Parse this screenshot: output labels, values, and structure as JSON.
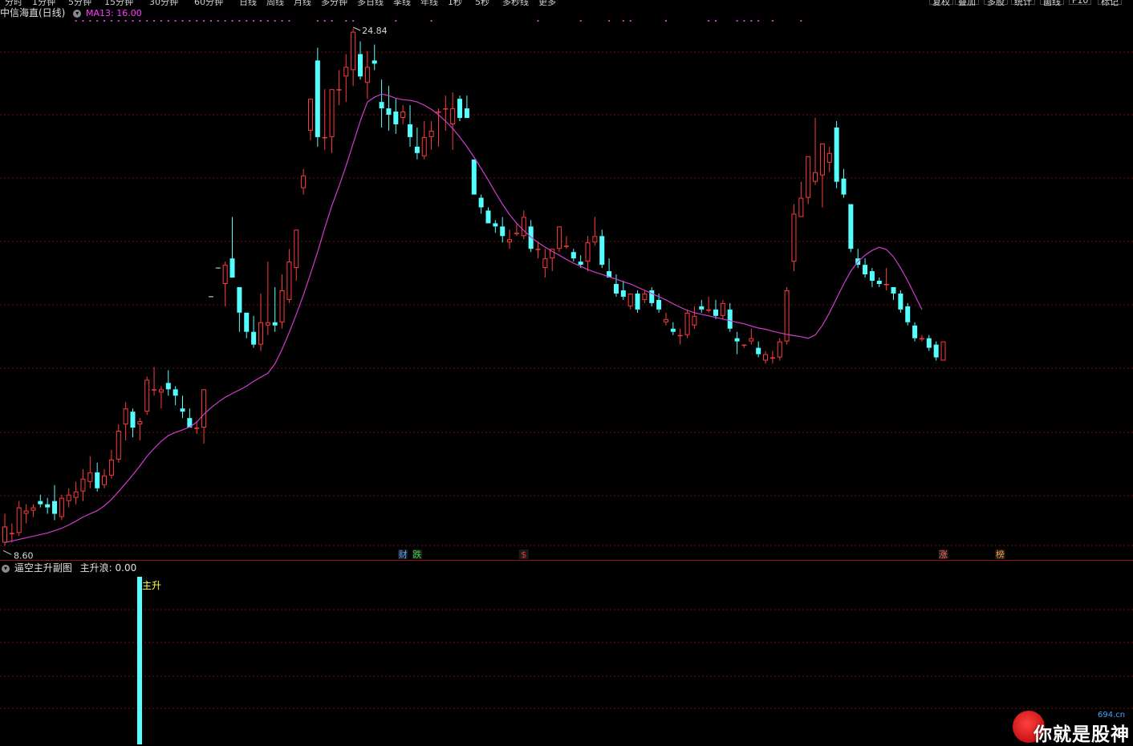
{
  "top_toolbar": {
    "period_tabs": [
      "分时",
      "1分钟",
      "5分钟",
      "15分钟",
      "30分钟",
      "60分钟",
      "日线",
      "周线",
      "月线",
      "多分钟",
      "多日线",
      "季线",
      "年线",
      "1秒",
      "5秒",
      "多秒线",
      "更多"
    ],
    "right_buttons": [
      "复权",
      "叠加",
      "多股",
      "统计",
      "画线",
      "F10",
      "标记"
    ]
  },
  "main_panel": {
    "stock_title": "中信海直(日线)",
    "ma_legend": "MA13: 16.00",
    "high_label": "24.84",
    "low_label": "8.60",
    "event_markers": [
      {
        "text": "财",
        "color": "#5aa0ff"
      },
      {
        "text": "跌",
        "color": "#3fd13f"
      },
      {
        "text": "$",
        "color": "#ff3030"
      },
      {
        "text": "涨",
        "color": "#ff6a6a"
      },
      {
        "text": "榜",
        "color": "#ff9a3a"
      }
    ]
  },
  "sub_panel": {
    "indicator_title": "逼空主升副图",
    "indicator_value": "主升浪: 0.00",
    "signal_label": "主升"
  },
  "watermark": {
    "text": "你就是股神",
    "sub": "694.cn"
  },
  "colors": {
    "up": "#ff3c3c",
    "down": "#54ffff",
    "ma": "#d03cd0",
    "grid": "#6e0f0f",
    "dot": "#d03cd0",
    "signal_bar": "#54ffff",
    "signal_text": "#ffff50"
  },
  "chart_data": {
    "type": "candlestick",
    "period": "daily",
    "y_range": [
      8.0,
      26.0
    ],
    "highest": 24.84,
    "lowest": 8.6,
    "ma_period": 13,
    "ma_last": 16.0,
    "candles": [
      {
        "o": 8.7,
        "h": 9.6,
        "l": 8.6,
        "c": 9.2
      },
      {
        "o": 9.0,
        "h": 9.3,
        "l": 8.7,
        "c": 9.0
      },
      {
        "o": 9.0,
        "h": 10.0,
        "l": 8.9,
        "c": 9.8
      },
      {
        "o": 9.6,
        "h": 9.9,
        "l": 9.3,
        "c": 9.7
      },
      {
        "o": 9.7,
        "h": 9.9,
        "l": 9.5,
        "c": 9.8
      },
      {
        "o": 10.0,
        "h": 10.2,
        "l": 9.8,
        "c": 9.9
      },
      {
        "o": 9.9,
        "h": 10.1,
        "l": 9.6,
        "c": 9.8
      },
      {
        "o": 10.0,
        "h": 10.5,
        "l": 9.4,
        "c": 9.6
      },
      {
        "o": 9.5,
        "h": 10.2,
        "l": 9.4,
        "c": 10.1
      },
      {
        "o": 10.0,
        "h": 10.4,
        "l": 9.8,
        "c": 10.2
      },
      {
        "o": 10.1,
        "h": 10.6,
        "l": 9.9,
        "c": 10.3
      },
      {
        "o": 10.3,
        "h": 11.0,
        "l": 10.0,
        "c": 10.7
      },
      {
        "o": 10.6,
        "h": 11.4,
        "l": 10.4,
        "c": 10.9
      },
      {
        "o": 10.9,
        "h": 11.2,
        "l": 10.3,
        "c": 10.4
      },
      {
        "o": 10.5,
        "h": 11.0,
        "l": 10.4,
        "c": 10.8
      },
      {
        "o": 10.8,
        "h": 11.6,
        "l": 10.7,
        "c": 11.3
      },
      {
        "o": 11.3,
        "h": 12.4,
        "l": 11.2,
        "c": 12.2
      },
      {
        "o": 12.4,
        "h": 13.1,
        "l": 11.9,
        "c": 12.9
      },
      {
        "o": 12.8,
        "h": 12.9,
        "l": 12.0,
        "c": 12.3
      },
      {
        "o": 12.4,
        "h": 12.6,
        "l": 11.9,
        "c": 12.5
      },
      {
        "o": 12.8,
        "h": 13.9,
        "l": 12.7,
        "c": 13.8
      },
      {
        "o": 13.5,
        "h": 14.2,
        "l": 13.3,
        "c": 13.5
      },
      {
        "o": 13.4,
        "h": 13.6,
        "l": 12.9,
        "c": 13.5
      },
      {
        "o": 13.7,
        "h": 14.1,
        "l": 13.3,
        "c": 13.5
      },
      {
        "o": 13.5,
        "h": 13.6,
        "l": 13.0,
        "c": 13.3
      },
      {
        "o": 12.9,
        "h": 13.3,
        "l": 12.6,
        "c": 12.8
      },
      {
        "o": 12.6,
        "h": 12.9,
        "l": 12.3,
        "c": 12.3
      },
      {
        "o": 12.3,
        "h": 12.5,
        "l": 12.1,
        "c": 12.3
      },
      {
        "o": 12.3,
        "h": 13.5,
        "l": 11.8,
        "c": 13.5
      },
      {
        "o": 16.4,
        "h": 16.4,
        "l": 16.4,
        "c": 16.4
      },
      {
        "o": 17.3,
        "h": 17.3,
        "l": 17.3,
        "c": 17.3
      },
      {
        "o": 16.8,
        "h": 17.5,
        "l": 16.1,
        "c": 17.4
      },
      {
        "o": 17.6,
        "h": 18.9,
        "l": 17.0,
        "c": 17.0
      },
      {
        "o": 16.7,
        "h": 16.7,
        "l": 15.3,
        "c": 15.9
      },
      {
        "o": 15.9,
        "h": 15.9,
        "l": 15.1,
        "c": 15.3
      },
      {
        "o": 15.3,
        "h": 15.8,
        "l": 14.8,
        "c": 14.9
      },
      {
        "o": 14.9,
        "h": 16.5,
        "l": 14.7,
        "c": 15.6
      },
      {
        "o": 15.5,
        "h": 17.5,
        "l": 15.2,
        "c": 15.6
      },
      {
        "o": 15.6,
        "h": 16.7,
        "l": 15.3,
        "c": 15.5
      },
      {
        "o": 15.6,
        "h": 17.1,
        "l": 15.4,
        "c": 16.6
      },
      {
        "o": 16.3,
        "h": 17.9,
        "l": 16.2,
        "c": 17.5
      },
      {
        "o": 17.3,
        "h": 18.5,
        "l": 16.9,
        "c": 18.5
      },
      {
        "o": 19.8,
        "h": 20.4,
        "l": 19.6,
        "c": 20.2
      },
      {
        "o": 21.6,
        "h": 22.6,
        "l": 21.3,
        "c": 22.6
      },
      {
        "o": 23.8,
        "h": 24.2,
        "l": 21.1,
        "c": 21.4
      },
      {
        "o": 21.4,
        "h": 22.9,
        "l": 21.0,
        "c": 21.4
      },
      {
        "o": 21.4,
        "h": 22.9,
        "l": 20.9,
        "c": 22.9
      },
      {
        "o": 22.9,
        "h": 23.5,
        "l": 22.4,
        "c": 22.9
      },
      {
        "o": 23.3,
        "h": 24.0,
        "l": 22.5,
        "c": 23.6
      },
      {
        "o": 23.5,
        "h": 24.8,
        "l": 23.0,
        "c": 24.7
      },
      {
        "o": 24.0,
        "h": 24.4,
        "l": 23.2,
        "c": 23.3
      },
      {
        "o": 23.1,
        "h": 24.1,
        "l": 22.6,
        "c": 23.6
      },
      {
        "o": 23.8,
        "h": 24.3,
        "l": 23.5,
        "c": 23.7
      },
      {
        "o": 22.5,
        "h": 23.2,
        "l": 21.7,
        "c": 22.3
      },
      {
        "o": 22.3,
        "h": 23.0,
        "l": 21.6,
        "c": 22.1
      },
      {
        "o": 22.2,
        "h": 22.6,
        "l": 21.5,
        "c": 21.8
      },
      {
        "o": 22.0,
        "h": 22.4,
        "l": 21.8,
        "c": 22.2
      },
      {
        "o": 21.8,
        "h": 22.4,
        "l": 21.1,
        "c": 21.4
      },
      {
        "o": 21.1,
        "h": 21.7,
        "l": 20.7,
        "c": 20.9
      },
      {
        "o": 20.8,
        "h": 21.9,
        "l": 20.7,
        "c": 21.4
      },
      {
        "o": 21.4,
        "h": 21.9,
        "l": 21.0,
        "c": 21.6
      },
      {
        "o": 22.2,
        "h": 22.3,
        "l": 21.1,
        "c": 22.2
      },
      {
        "o": 22.3,
        "h": 22.7,
        "l": 21.6,
        "c": 22.3
      },
      {
        "o": 21.8,
        "h": 22.8,
        "l": 21.0,
        "c": 22.3
      },
      {
        "o": 22.6,
        "h": 22.7,
        "l": 21.9,
        "c": 22.0
      },
      {
        "o": 22.3,
        "h": 22.7,
        "l": 22.0,
        "c": 22.0
      },
      {
        "o": 20.7,
        "h": 20.7,
        "l": 19.6,
        "c": 19.6
      },
      {
        "o": 19.5,
        "h": 19.6,
        "l": 19.0,
        "c": 19.2
      },
      {
        "o": 19.1,
        "h": 19.2,
        "l": 18.7,
        "c": 18.7
      },
      {
        "o": 18.7,
        "h": 18.8,
        "l": 18.4,
        "c": 18.6
      },
      {
        "o": 18.6,
        "h": 18.9,
        "l": 18.1,
        "c": 18.3
      },
      {
        "o": 18.1,
        "h": 18.5,
        "l": 17.9,
        "c": 18.2
      },
      {
        "o": 18.4,
        "h": 18.7,
        "l": 18.3,
        "c": 18.4
      },
      {
        "o": 18.3,
        "h": 19.1,
        "l": 18.2,
        "c": 18.9
      },
      {
        "o": 18.6,
        "h": 18.8,
        "l": 17.8,
        "c": 17.9
      },
      {
        "o": 17.9,
        "h": 18.1,
        "l": 17.6,
        "c": 17.9
      },
      {
        "o": 17.3,
        "h": 17.9,
        "l": 17.0,
        "c": 17.6
      },
      {
        "o": 17.6,
        "h": 17.9,
        "l": 17.2,
        "c": 17.9
      },
      {
        "o": 17.9,
        "h": 18.6,
        "l": 17.8,
        "c": 18.6
      },
      {
        "o": 18.0,
        "h": 18.3,
        "l": 17.9,
        "c": 18.0
      },
      {
        "o": 17.8,
        "h": 17.9,
        "l": 17.5,
        "c": 17.6
      },
      {
        "o": 17.5,
        "h": 17.7,
        "l": 17.3,
        "c": 17.4
      },
      {
        "o": 17.5,
        "h": 18.3,
        "l": 17.2,
        "c": 18.1
      },
      {
        "o": 18.1,
        "h": 18.9,
        "l": 18.0,
        "c": 18.3
      },
      {
        "o": 18.3,
        "h": 18.5,
        "l": 17.3,
        "c": 17.4
      },
      {
        "o": 17.2,
        "h": 17.6,
        "l": 17.0,
        "c": 17.0
      },
      {
        "o": 16.8,
        "h": 17.1,
        "l": 16.4,
        "c": 16.5
      },
      {
        "o": 16.6,
        "h": 16.9,
        "l": 16.3,
        "c": 16.4
      },
      {
        "o": 16.1,
        "h": 16.5,
        "l": 16.0,
        "c": 16.5
      },
      {
        "o": 16.5,
        "h": 16.6,
        "l": 15.9,
        "c": 16.0
      },
      {
        "o": 16.3,
        "h": 16.6,
        "l": 16.2,
        "c": 16.5
      },
      {
        "o": 16.6,
        "h": 16.7,
        "l": 16.1,
        "c": 16.2
      },
      {
        "o": 16.3,
        "h": 16.5,
        "l": 15.9,
        "c": 16.0
      },
      {
        "o": 15.6,
        "h": 15.9,
        "l": 15.5,
        "c": 15.7
      },
      {
        "o": 15.4,
        "h": 15.6,
        "l": 15.2,
        "c": 15.3
      },
      {
        "o": 15.2,
        "h": 15.4,
        "l": 14.9,
        "c": 15.2
      },
      {
        "o": 15.2,
        "h": 16.0,
        "l": 15.1,
        "c": 15.9
      },
      {
        "o": 15.5,
        "h": 16.1,
        "l": 15.4,
        "c": 15.8
      },
      {
        "o": 16.1,
        "h": 16.3,
        "l": 15.9,
        "c": 16.0
      },
      {
        "o": 16.0,
        "h": 16.4,
        "l": 15.9,
        "c": 16.0
      },
      {
        "o": 16.0,
        "h": 16.3,
        "l": 15.7,
        "c": 15.8
      },
      {
        "o": 15.8,
        "h": 16.3,
        "l": 15.7,
        "c": 16.2
      },
      {
        "o": 16.0,
        "h": 16.2,
        "l": 15.3,
        "c": 15.4
      },
      {
        "o": 15.1,
        "h": 15.3,
        "l": 14.6,
        "c": 15.0
      },
      {
        "o": 14.9,
        "h": 14.9,
        "l": 14.8,
        "c": 14.9
      },
      {
        "o": 15.0,
        "h": 15.4,
        "l": 14.9,
        "c": 15.1
      },
      {
        "o": 14.8,
        "h": 15.0,
        "l": 14.5,
        "c": 14.6
      },
      {
        "o": 14.4,
        "h": 14.7,
        "l": 14.3,
        "c": 14.6
      },
      {
        "o": 14.5,
        "h": 14.7,
        "l": 14.3,
        "c": 14.5
      },
      {
        "o": 14.5,
        "h": 15.1,
        "l": 14.4,
        "c": 15.0
      },
      {
        "o": 15.0,
        "h": 16.7,
        "l": 14.9,
        "c": 16.6
      },
      {
        "o": 17.5,
        "h": 19.3,
        "l": 17.2,
        "c": 19.0
      },
      {
        "o": 18.9,
        "h": 20.0,
        "l": 18.9,
        "c": 19.5
      },
      {
        "o": 19.5,
        "h": 20.8,
        "l": 19.3,
        "c": 20.8
      },
      {
        "o": 20.0,
        "h": 22.0,
        "l": 19.9,
        "c": 20.3
      },
      {
        "o": 20.2,
        "h": 21.2,
        "l": 19.2,
        "c": 21.2
      },
      {
        "o": 20.6,
        "h": 21.1,
        "l": 20.3,
        "c": 20.9
      },
      {
        "o": 21.7,
        "h": 21.9,
        "l": 19.8,
        "c": 20.0
      },
      {
        "o": 20.1,
        "h": 20.4,
        "l": 19.5,
        "c": 19.6
      },
      {
        "o": 19.3,
        "h": 19.3,
        "l": 17.8,
        "c": 17.9
      },
      {
        "o": 17.6,
        "h": 17.9,
        "l": 17.3,
        "c": 17.4
      },
      {
        "o": 17.4,
        "h": 17.6,
        "l": 17.0,
        "c": 17.1
      },
      {
        "o": 17.2,
        "h": 17.3,
        "l": 16.7,
        "c": 16.9
      },
      {
        "o": 16.9,
        "h": 17.0,
        "l": 16.7,
        "c": 16.8
      },
      {
        "o": 16.8,
        "h": 17.3,
        "l": 16.6,
        "c": 16.8
      },
      {
        "o": 16.7,
        "h": 16.7,
        "l": 16.3,
        "c": 16.5
      },
      {
        "o": 16.5,
        "h": 16.6,
        "l": 15.9,
        "c": 16.0
      },
      {
        "o": 16.1,
        "h": 16.2,
        "l": 15.5,
        "c": 15.6
      },
      {
        "o": 15.5,
        "h": 15.6,
        "l": 15.0,
        "c": 15.1
      },
      {
        "o": 15.1,
        "h": 15.2,
        "l": 15.0,
        "c": 15.1
      },
      {
        "o": 15.1,
        "h": 15.2,
        "l": 14.7,
        "c": 14.8
      },
      {
        "o": 14.9,
        "h": 15.0,
        "l": 14.4,
        "c": 14.5
      },
      {
        "o": 14.4,
        "h": 15.0,
        "l": 14.4,
        "c": 15.0
      }
    ],
    "ma13": [
      8.7,
      8.75,
      8.8,
      8.85,
      8.9,
      8.95,
      9.0,
      9.07,
      9.15,
      9.25,
      9.37,
      9.5,
      9.6,
      9.7,
      9.85,
      10.05,
      10.3,
      10.55,
      10.82,
      11.1,
      11.4,
      11.65,
      11.87,
      12.05,
      12.15,
      12.23,
      12.32,
      12.47,
      12.72,
      12.92,
      13.1,
      13.25,
      13.37,
      13.48,
      13.6,
      13.75,
      13.88,
      14.0,
      14.3,
      14.75,
      15.28,
      15.85,
      16.45,
      17.12,
      17.8,
      18.55,
      19.25,
      19.85,
      20.5,
      21.2,
      21.9,
      22.5,
      22.65,
      22.75,
      22.7,
      22.62,
      22.57,
      22.55,
      22.5,
      22.4,
      22.27,
      22.1,
      21.9,
      21.67,
      21.4,
      21.1,
      20.77,
      20.42,
      20.05,
      19.67,
      19.3,
      18.97,
      18.7,
      18.47,
      18.27,
      18.1,
      17.95,
      17.82,
      17.7,
      17.57,
      17.45,
      17.35,
      17.25,
      17.17,
      17.1,
      17.02,
      16.95,
      16.87,
      16.8,
      16.7,
      16.6,
      16.5,
      16.4,
      16.3,
      16.18,
      16.07,
      15.97,
      15.9,
      15.85,
      15.8,
      15.75,
      15.7,
      15.65,
      15.6,
      15.55,
      15.48,
      15.42,
      15.38,
      15.32,
      15.27,
      15.22,
      15.18,
      15.15,
      15.1,
      15.2,
      15.5,
      15.9,
      16.35,
      16.8,
      17.2,
      17.5,
      17.7,
      17.85,
      17.95,
      17.88,
      17.65,
      17.3,
      16.9,
      16.45,
      16.0
    ],
    "signal_dots_at": [
      10,
      11,
      12,
      13,
      14,
      15,
      16,
      17,
      18,
      19,
      20,
      21,
      22,
      23,
      24,
      25,
      26,
      27,
      28,
      29,
      30,
      31,
      32,
      33,
      34,
      35,
      36,
      37,
      38,
      39,
      40,
      44,
      45,
      46,
      48,
      49,
      55,
      60,
      75,
      81,
      85,
      87,
      88,
      93,
      99,
      100,
      103,
      104,
      105,
      106,
      108,
      112
    ]
  }
}
